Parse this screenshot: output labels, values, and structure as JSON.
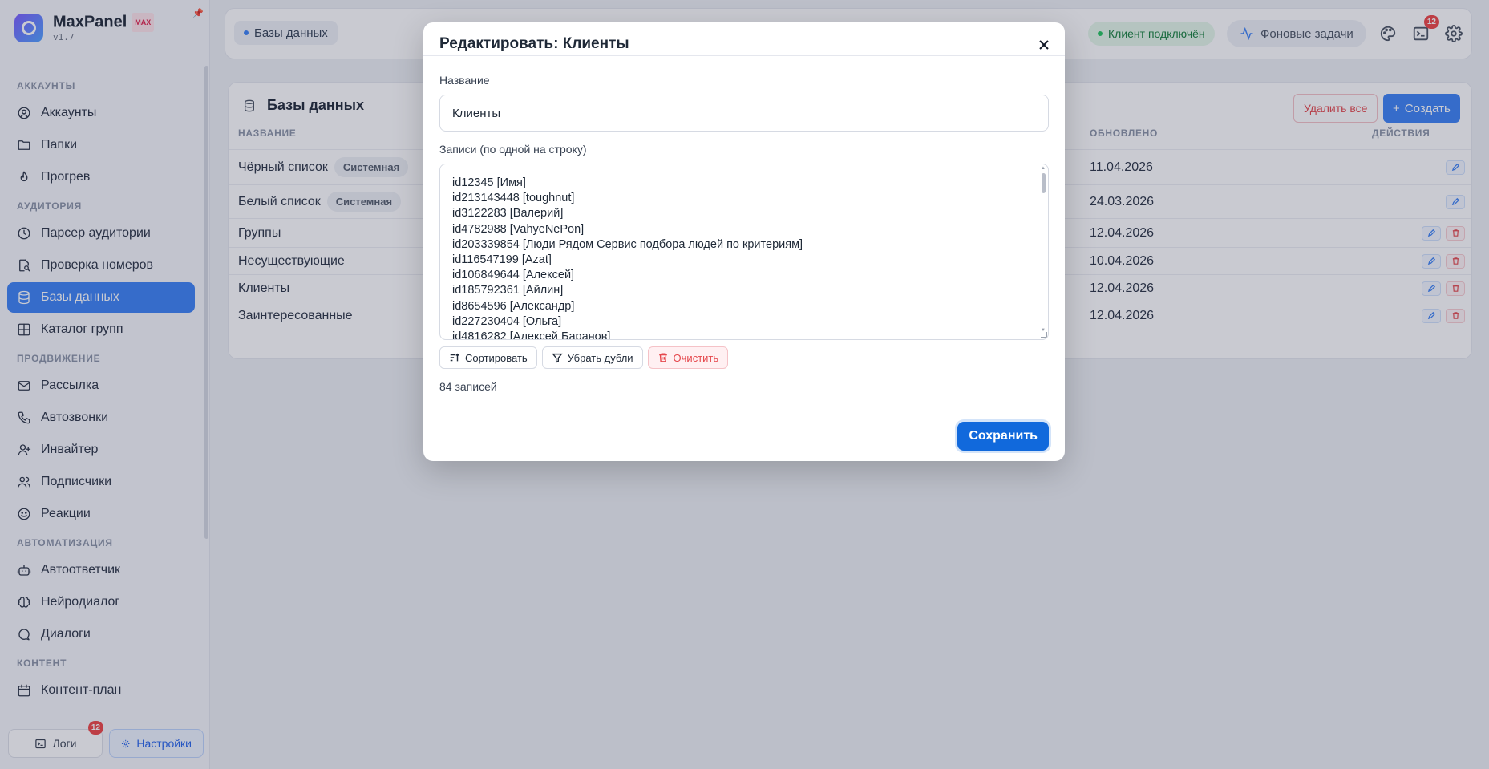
{
  "brand": {
    "name": "MaxPanel",
    "badge": "MAX",
    "version": "v1.7"
  },
  "sidebar": {
    "sections": [
      {
        "title": "АККАУНТЫ",
        "items": [
          {
            "label": "Аккаунты",
            "icon": "user-circle-icon"
          },
          {
            "label": "Папки",
            "icon": "folder-icon"
          },
          {
            "label": "Прогрев",
            "icon": "flame-icon"
          }
        ]
      },
      {
        "title": "АУДИТОРИЯ",
        "items": [
          {
            "label": "Парсер аудитории",
            "icon": "clock-icon"
          },
          {
            "label": "Проверка номеров",
            "icon": "search-file-icon"
          },
          {
            "label": "Базы данных",
            "icon": "database-icon",
            "active": true
          },
          {
            "label": "Каталог групп",
            "icon": "grid-icon"
          }
        ]
      },
      {
        "title": "ПРОДВИЖЕНИЕ",
        "items": [
          {
            "label": "Рассылка",
            "icon": "mail-icon"
          },
          {
            "label": "Автозвонки",
            "icon": "phone-icon"
          },
          {
            "label": "Инвайтер",
            "icon": "user-plus-icon"
          },
          {
            "label": "Подписчики",
            "icon": "users-icon"
          },
          {
            "label": "Реакции",
            "icon": "smile-icon"
          }
        ]
      },
      {
        "title": "АВТОМАТИЗАЦИЯ",
        "items": [
          {
            "label": "Автоответчик",
            "icon": "bot-icon"
          },
          {
            "label": "Нейродиалог",
            "icon": "brain-icon"
          },
          {
            "label": "Диалоги",
            "icon": "message-icon"
          }
        ]
      },
      {
        "title": "КОНТЕНТ",
        "items": [
          {
            "label": "Контент-план",
            "icon": "calendar-icon"
          }
        ]
      }
    ],
    "footer": {
      "logs_label": "Логи",
      "logs_badge": "12",
      "settings_label": "Настройки"
    }
  },
  "topbar": {
    "breadcrumb": "Базы данных",
    "client_status": "Клиент подключён",
    "tasks_label": "Фоновые задачи",
    "terminal_badge": "12"
  },
  "page": {
    "title": "Базы данных",
    "delete_all_label": "Удалить все",
    "create_label": "Создать",
    "columns": {
      "name": "НАЗВАНИЕ",
      "updated": "ОБНОВЛЕНО",
      "actions": "ДЕЙСТВИЯ"
    },
    "rows": [
      {
        "name": "Чёрный список",
        "tag": "Системная",
        "updated": "11.04.2026",
        "deletable": false
      },
      {
        "name": "Белый список",
        "tag": "Системная",
        "updated": "24.03.2026",
        "deletable": false
      },
      {
        "name": "Группы",
        "tag": "",
        "updated": "12.04.2026",
        "deletable": true
      },
      {
        "name": "Несуществующие",
        "tag": "",
        "updated": "10.04.2026",
        "deletable": true
      },
      {
        "name": "Клиенты",
        "tag": "",
        "updated": "12.04.2026",
        "deletable": true
      },
      {
        "name": "Заинтересованные",
        "tag": "",
        "updated": "12.04.2026",
        "deletable": true
      }
    ]
  },
  "modal": {
    "title": "Редактировать: Клиенты",
    "name_label": "Название",
    "name_value": "Клиенты",
    "records_label": "Записи (по одной на строку)",
    "records": [
      "id12345 [Имя]",
      "id213143448 [toughnut]",
      "id3122283 [Валерий]",
      "id4782988 [VahyeNePon]",
      "id203339854 [Люди Рядом Сервис подбора людей по критериям]",
      "id116547199 [Azat]",
      "id106849644 [Алексей]",
      "id185792361 [Айлин]",
      "id8654596 [Александр]",
      "id227230404 [Ольга]",
      "id4816282 [Алексей Баранов]"
    ],
    "sort_label": "Сортировать",
    "dedupe_label": "Убрать дубли",
    "clear_label": "Очистить",
    "count_text": "84 записей",
    "save_label": "Сохранить"
  }
}
